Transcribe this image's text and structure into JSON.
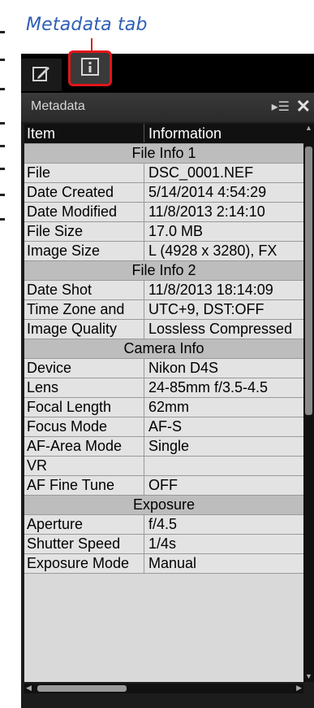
{
  "callout": {
    "label": "Metadata tab"
  },
  "tabs": [
    {
      "name": "adjustments-tab",
      "icon": "pencil-icon"
    },
    {
      "name": "metadata-tab",
      "icon": "info-icon",
      "active": true
    }
  ],
  "panel": {
    "title": "Metadata"
  },
  "columns": {
    "item": "Item",
    "information": "Information"
  },
  "rows": [
    {
      "type": "section",
      "label": "File Info 1"
    },
    {
      "type": "data",
      "item": "File",
      "info": "DSC_0001.NEF"
    },
    {
      "type": "data",
      "item": "Date Created",
      "info": "5/14/2014 4:54:29"
    },
    {
      "type": "data",
      "item": "Date Modified",
      "info": "11/8/2013 2:14:10"
    },
    {
      "type": "data",
      "item": "File Size",
      "info": "17.0 MB"
    },
    {
      "type": "data",
      "item": "Image Size",
      "info": "L (4928 x 3280), FX"
    },
    {
      "type": "section",
      "label": "File Info 2"
    },
    {
      "type": "data",
      "item": "Date Shot",
      "info": "11/8/2013 18:14:09"
    },
    {
      "type": "data",
      "item": "Time Zone and",
      "info": "UTC+9, DST:OFF"
    },
    {
      "type": "data",
      "item": "Image Quality",
      "info": "Lossless Compressed"
    },
    {
      "type": "section",
      "label": "Camera Info"
    },
    {
      "type": "data",
      "item": "Device",
      "info": "Nikon D4S"
    },
    {
      "type": "data",
      "item": "Lens",
      "info": "24-85mm f/3.5-4.5"
    },
    {
      "type": "data",
      "item": "Focal Length",
      "info": "62mm"
    },
    {
      "type": "data",
      "item": "Focus Mode",
      "info": "AF-S"
    },
    {
      "type": "data",
      "item": "AF-Area Mode",
      "info": "Single"
    },
    {
      "type": "data",
      "item": "VR",
      "info": ""
    },
    {
      "type": "data",
      "item": "AF Fine Tune",
      "info": "OFF"
    },
    {
      "type": "section",
      "label": "Exposure"
    },
    {
      "type": "data",
      "item": "Aperture",
      "info": "f/4.5"
    },
    {
      "type": "data",
      "item": "Shutter Speed",
      "info": "1/4s"
    },
    {
      "type": "data",
      "item": "Exposure Mode",
      "info": "Manual"
    }
  ]
}
